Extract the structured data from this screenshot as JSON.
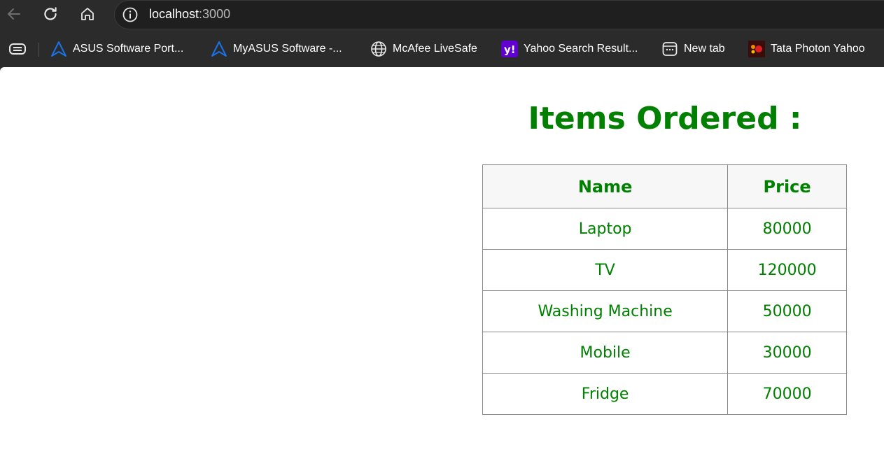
{
  "browser": {
    "url_host": "localhost",
    "url_port": ":3000",
    "bookmarks": [
      {
        "label": "ASUS Software Port...",
        "icon": "asus-icon"
      },
      {
        "label": "MyASUS Software -...",
        "icon": "asus-icon"
      },
      {
        "label": "McAfee LiveSafe",
        "icon": "globe-icon"
      },
      {
        "label": "Yahoo Search Result...",
        "icon": "yahoo-icon"
      },
      {
        "label": "New tab",
        "icon": "new-tab-icon"
      },
      {
        "label": "Tata Photon Yahoo",
        "icon": "tata-photon-icon"
      }
    ]
  },
  "page": {
    "title": "Items Ordered :",
    "table": {
      "headers": [
        "Name",
        "Price"
      ],
      "rows": [
        [
          "Laptop",
          "80000"
        ],
        [
          "TV",
          "120000"
        ],
        [
          "Washing Machine",
          "50000"
        ],
        [
          "Mobile",
          "30000"
        ],
        [
          "Fridge",
          "70000"
        ]
      ]
    }
  },
  "colors": {
    "text_green": "#008000",
    "browser_bg": "#2b2b2b",
    "accent_blue": "#1a73e8",
    "yahoo_purple": "#6001d2"
  }
}
